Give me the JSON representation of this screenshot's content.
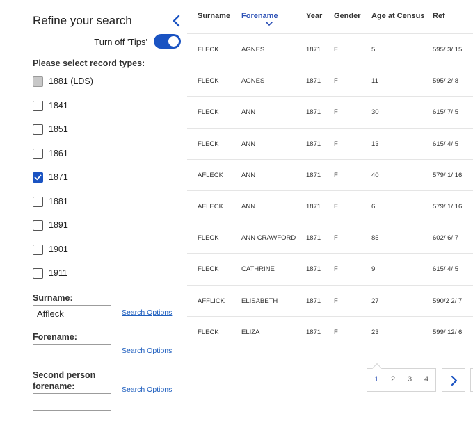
{
  "sidebar": {
    "title": "Refine your search",
    "tips_toggle_label": "Turn off 'Tips'",
    "record_types_label": "Please select record types:",
    "record_types": [
      {
        "label": "1881 (LDS)",
        "state": "disabled"
      },
      {
        "label": "1841",
        "state": "unchecked"
      },
      {
        "label": "1851",
        "state": "unchecked"
      },
      {
        "label": "1861",
        "state": "unchecked"
      },
      {
        "label": "1871",
        "state": "checked"
      },
      {
        "label": "1881",
        "state": "unchecked"
      },
      {
        "label": "1891",
        "state": "unchecked"
      },
      {
        "label": "1901",
        "state": "unchecked"
      },
      {
        "label": "1911",
        "state": "unchecked"
      }
    ],
    "fields": {
      "surname": {
        "label": "Surname:",
        "value": "Affleck",
        "search_options": "Search Options"
      },
      "forename": {
        "label": "Forename:",
        "value": "",
        "search_options": "Search Options"
      },
      "second_forename": {
        "label_line1": "Second person",
        "label_line2": "forename:",
        "value": "",
        "search_options": "Search Options"
      }
    },
    "accent_color": "#1a53c2"
  },
  "table": {
    "headers": {
      "surname": "Surname",
      "forename": "Forename",
      "year": "Year",
      "gender": "Gender",
      "age": "Age at Census",
      "ref": "Ref"
    },
    "sorted_by": "forename",
    "sort_icon": "chevron-down-icon",
    "rows": [
      [
        "FLECK",
        "AGNES",
        "1871",
        "F",
        "5",
        "595/ 3/ 15"
      ],
      [
        "FLECK",
        "AGNES",
        "1871",
        "F",
        "11",
        "595/ 2/ 8"
      ],
      [
        "FLECK",
        "ANN",
        "1871",
        "F",
        "30",
        "615/ 7/ 5"
      ],
      [
        "FLECK",
        "ANN",
        "1871",
        "F",
        "13",
        "615/ 4/ 5"
      ],
      [
        "AFLECK",
        "ANN",
        "1871",
        "F",
        "40",
        "579/ 1/ 16"
      ],
      [
        "AFLECK",
        "ANN",
        "1871",
        "F",
        "6",
        "579/ 1/ 16"
      ],
      [
        "FLECK",
        "ANN CRAWFORD",
        "1871",
        "F",
        "85",
        "602/ 6/ 7"
      ],
      [
        "FLECK",
        "CATHRINE",
        "1871",
        "F",
        "9",
        "615/ 4/ 5"
      ],
      [
        "AFFLICK",
        "ELISABETH",
        "1871",
        "F",
        "27",
        "590/2 2/ 7"
      ],
      [
        "FLECK",
        "ELIZA",
        "1871",
        "F",
        "23",
        "599/ 12/ 6"
      ]
    ]
  },
  "pagination": {
    "pages": [
      "1",
      "2",
      "3",
      "4"
    ],
    "current": "1",
    "next_icon": "chevron-right-icon"
  }
}
